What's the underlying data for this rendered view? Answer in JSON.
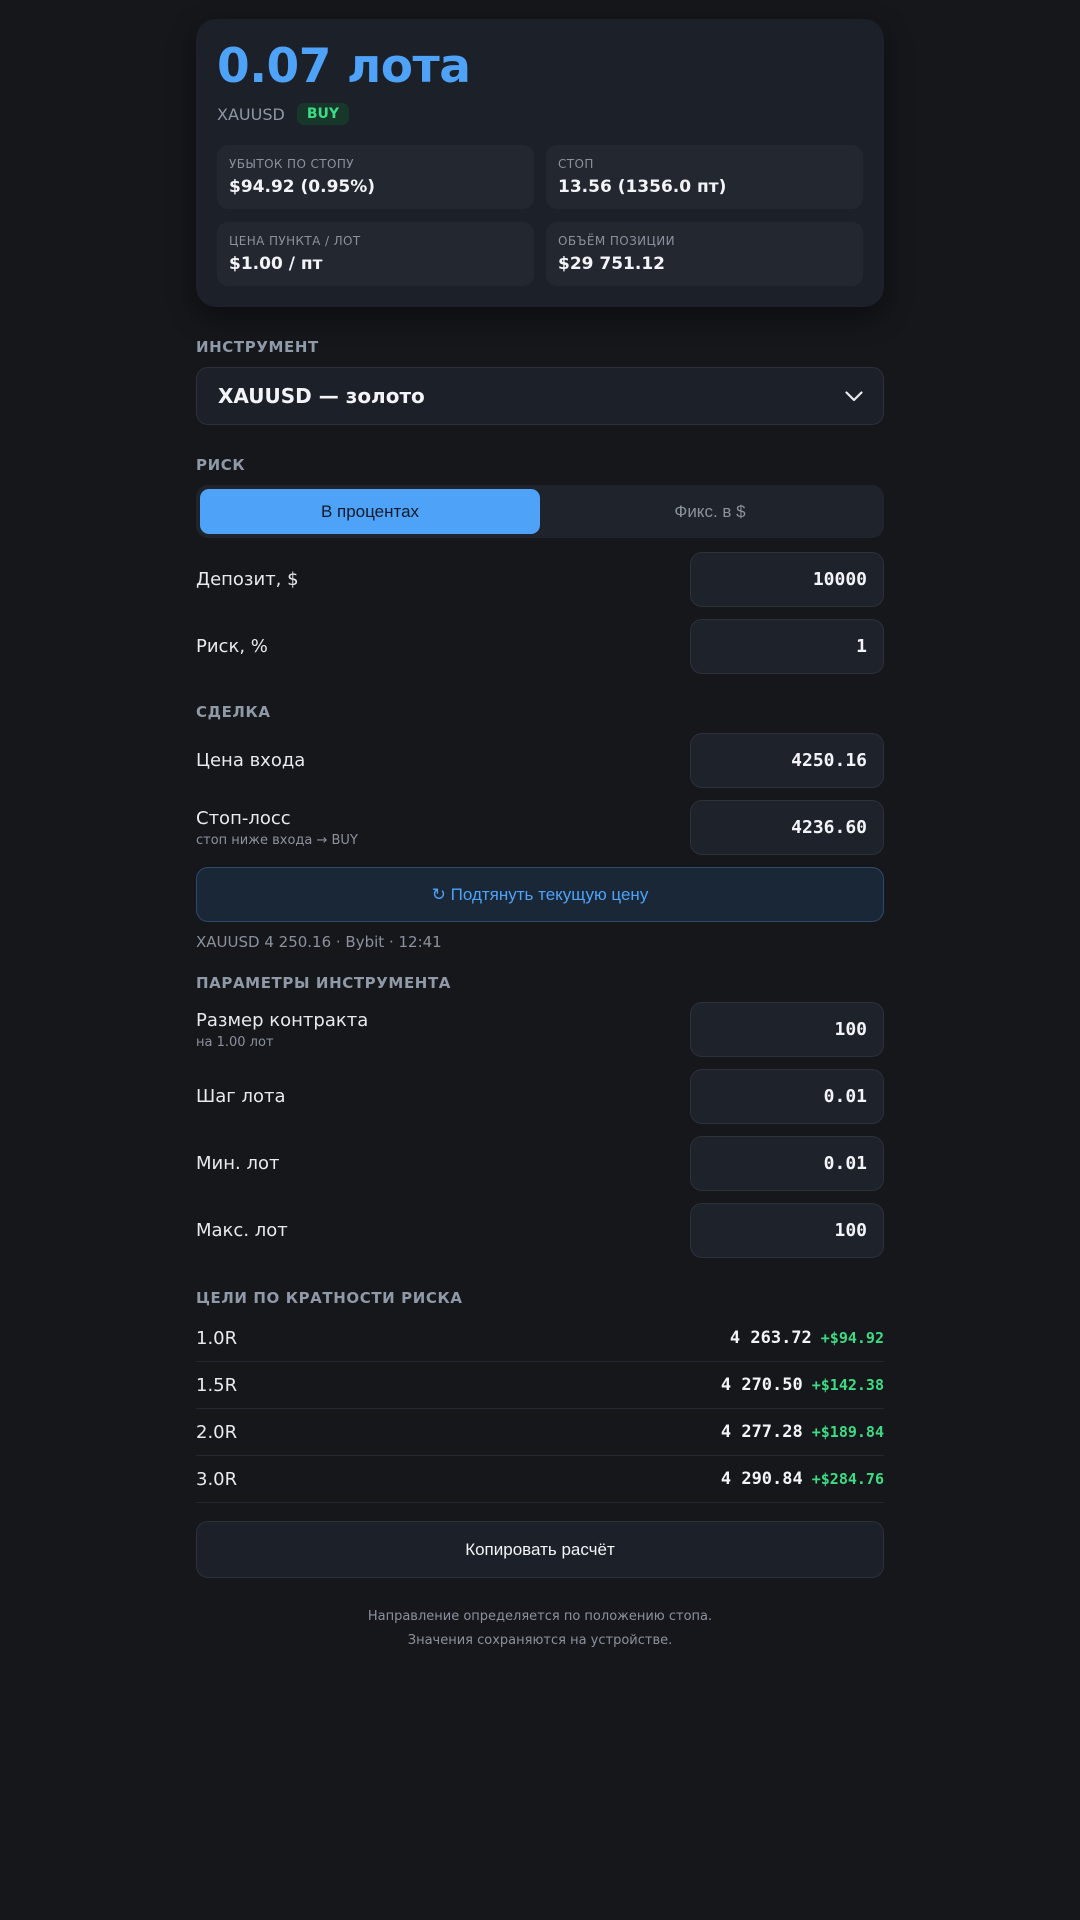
{
  "summary": {
    "lots": "0.07 лота",
    "symbol": "XAUUSD",
    "direction": "BUY",
    "cells": [
      {
        "label": "УБЫТОК ПО СТОПУ",
        "value": "$94.92 (0.95%)"
      },
      {
        "label": "СТОП",
        "value": "13.56 (1356.0 пт)"
      },
      {
        "label": "ЦЕНА ПУНКТА / ЛОТ",
        "value": "$1.00 / пт"
      },
      {
        "label": "ОБЪЁМ ПОЗИЦИИ",
        "value": "$29 751.12"
      }
    ]
  },
  "instrument": {
    "section_label": "ИНСТРУМЕНТ",
    "selected": "XAUUSD — золото",
    "icon": "chevron-down-icon"
  },
  "risk": {
    "section_label": "РИСК",
    "mode_percent": "В процентах",
    "mode_fixed": "Фикс. в $",
    "deposit_label": "Депозит, $",
    "deposit_value": "10000",
    "risk_label": "Риск, %",
    "risk_value": "1"
  },
  "trade": {
    "section_label": "СДЕЛКА",
    "entry_label": "Цена входа",
    "entry_value": "4250.16",
    "stop_label": "Стоп-лосс",
    "stop_hint": "стоп ниже входа → BUY",
    "stop_value": "4236.60",
    "fetch_button": "↻ Подтянуть текущую цену",
    "price_status": "XAUUSD 4 250.16 · Bybit · 12:41"
  },
  "params": {
    "section_label": "ПАРАМЕТРЫ ИНСТРУМЕНТА",
    "contract_label": "Размер контракта",
    "contract_hint": "на 1.00 лот",
    "contract_value": "100",
    "step_label": "Шаг лота",
    "step_value": "0.01",
    "min_label": "Мин. лот",
    "min_value": "0.01",
    "max_label": "Макс. лот",
    "max_value": "100"
  },
  "targets": {
    "section_label": "ЦЕЛИ ПО КРАТНОСТИ РИСКА",
    "rows": [
      {
        "r": "1.0R",
        "price": "4 263.72",
        "profit": "+$94.92"
      },
      {
        "r": "1.5R",
        "price": "4 270.50",
        "profit": "+$142.38"
      },
      {
        "r": "2.0R",
        "price": "4 277.28",
        "profit": "+$189.84"
      },
      {
        "r": "3.0R",
        "price": "4 290.84",
        "profit": "+$284.76"
      }
    ]
  },
  "copy_button": "Копировать расчёт",
  "footer": {
    "line1": "Направление определяется по положению стопа.",
    "line2": "Значения сохраняются на устройстве."
  },
  "colors": {
    "accent": "#4ea2f7",
    "profit": "#3ddc84",
    "background": "#15171b",
    "card": "#1c2028"
  }
}
